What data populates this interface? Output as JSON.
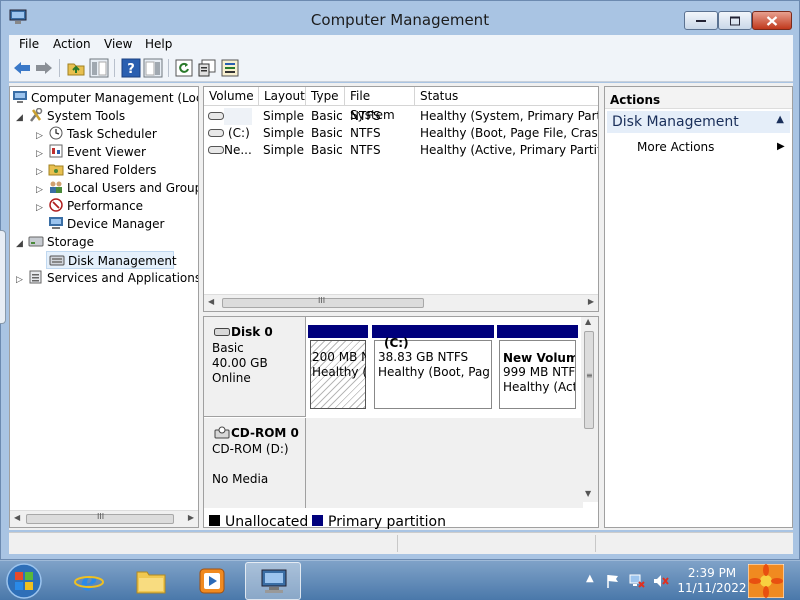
{
  "window": {
    "title": "Computer Management"
  },
  "menu": [
    "File",
    "Action",
    "View",
    "Help"
  ],
  "tree": {
    "root": "Computer Management (Local",
    "system_tools": "System Tools",
    "task_scheduler": "Task Scheduler",
    "event_viewer": "Event Viewer",
    "shared_folders": "Shared Folders",
    "local_users": "Local Users and Groups",
    "performance": "Performance",
    "device_manager": "Device Manager",
    "storage": "Storage",
    "disk_management": "Disk Management",
    "services": "Services and Applications"
  },
  "volumes": {
    "columns": [
      "Volume",
      "Layout",
      "Type",
      "File System",
      "Status"
    ],
    "rows": [
      {
        "volume": "",
        "layout": "Simple",
        "type": "Basic",
        "fs": "NTFS",
        "status": "Healthy (System, Primary Partition"
      },
      {
        "volume": "(C:)",
        "layout": "Simple",
        "type": "Basic",
        "fs": "NTFS",
        "status": "Healthy (Boot, Page File, Crash Du"
      },
      {
        "volume": "Ne...",
        "layout": "Simple",
        "type": "Basic",
        "fs": "NTFS",
        "status": "Healthy (Active, Primary Partition"
      }
    ],
    "scroll_glyph": "III"
  },
  "disk0": {
    "name": "Disk 0",
    "type": "Basic",
    "size": "40.00 GB",
    "state": "Online",
    "partitions": [
      {
        "name": "",
        "size": "200 MB N",
        "status": "Healthy ("
      },
      {
        "name": "(C:)",
        "size": "38.83 GB NTFS",
        "status": "Healthy (Boot, Page"
      },
      {
        "name": "New Volum",
        "size": "999 MB NTFS",
        "status": "Healthy (Act"
      }
    ]
  },
  "cdrom": {
    "name": "CD-ROM 0",
    "drive": "CD-ROM (D:)",
    "media": "No Media"
  },
  "legend": {
    "unallocated": "Unallocated",
    "primary": "Primary partition"
  },
  "actions": {
    "header": "Actions",
    "section": "Disk Management",
    "more": "More Actions"
  },
  "clock": {
    "time": "2:39 PM",
    "date": "11/11/2022"
  },
  "colors": {
    "primary_partition": "#00007c",
    "unallocated": "#000000"
  }
}
